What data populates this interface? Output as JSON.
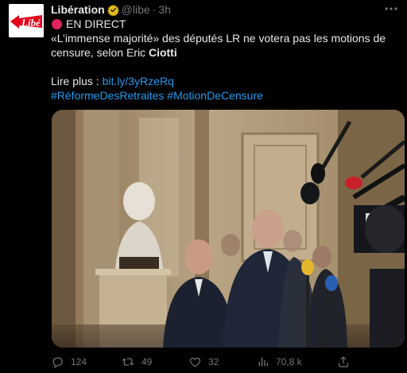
{
  "tweet": {
    "display_name": "Libération",
    "handle": "@libe",
    "separator": "·",
    "time": "3h",
    "avatar_logo_text": "Libé",
    "text": {
      "line1": "EN DIRECT",
      "line2": "«L’immense majorité» des députés LR ne votera pas les motions de",
      "line3_prefix": "censure, selon Eric ",
      "line3_bold": "Ciotti",
      "link_prefix": "Lire plus : ",
      "link_url": "bit.ly/3yRzeRq",
      "hashtag1": "#RéformeDesRetraites",
      "hashtag2": "#MotionDeCensure"
    }
  },
  "actions": {
    "replies": "124",
    "retweets": "49",
    "likes": "32",
    "views": "70,8 k"
  },
  "colors": {
    "background": "#000000",
    "text": "#e7e9ea",
    "muted": "#71767b",
    "link": "#1d9bf0",
    "verified": "#e2b719",
    "live_dot": "#e0245e",
    "logo_red": "#e3001b"
  },
  "icons": [
    "verified-badge-icon",
    "more-options-icon",
    "reply-icon",
    "retweet-icon",
    "like-icon",
    "views-icon",
    "share-icon"
  ]
}
